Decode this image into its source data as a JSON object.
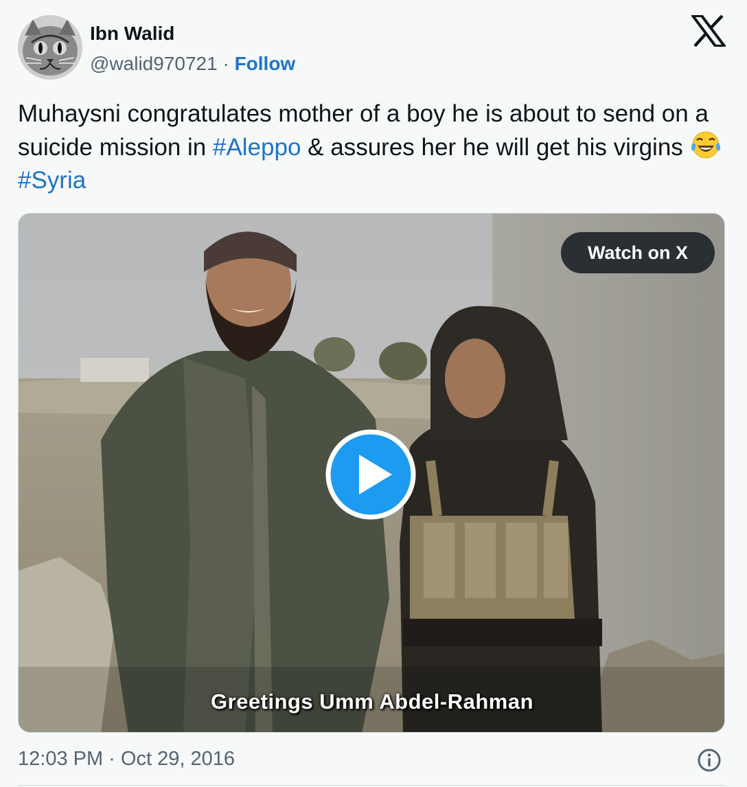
{
  "author": {
    "name": "Ibn Walid",
    "handle": "@walid970721",
    "separator": "·",
    "follow_label": "Follow"
  },
  "brand": {
    "logo_icon": "x-logo-icon"
  },
  "tweet": {
    "text_part1": "Muhaysni congratulates mother of a boy he is about to send on a suicide mission in ",
    "hashtag1": "#Aleppo",
    "text_part2": " & assures her he will get his virgins ",
    "emoji": "face-with-tears-of-joy",
    "hashtag2": "#Syria"
  },
  "media": {
    "watch_label": "Watch on X",
    "play_icon": "play-icon",
    "caption": "Greetings Umm Abdel-Rahman"
  },
  "footer": {
    "timestamp": "12:03 PM · Oct 29, 2016",
    "info_icon": "info-icon"
  },
  "colors": {
    "link": "#1d74c9",
    "text": "#0f1419",
    "muted": "#536471",
    "background": "#f7f9f9",
    "play_blue": "#1d9bf0"
  }
}
